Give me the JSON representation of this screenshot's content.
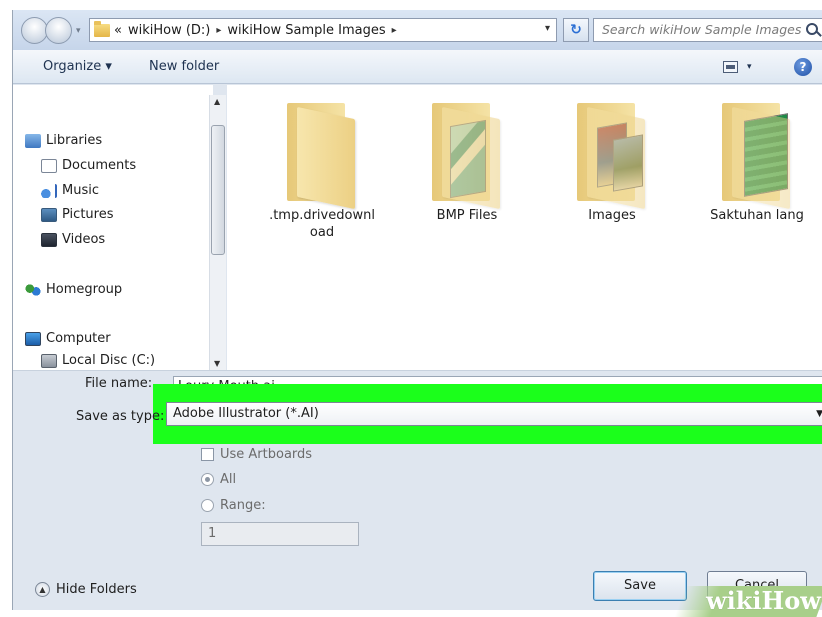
{
  "address_bar": {
    "crumb_prefix": "«",
    "crumbs": [
      "wikiHow (D:)",
      "wikiHow Sample Images"
    ],
    "separator": "▸",
    "search_placeholder": "Search wikiHow Sample Images"
  },
  "toolbar": {
    "organize_label": "Organize ▾",
    "new_folder_label": "New folder",
    "view_drop": "▾",
    "help_glyph": "?"
  },
  "nav_pane": {
    "items": [
      {
        "label": "Libraries",
        "icon": "libraries-icon"
      },
      {
        "label": "Documents",
        "icon": "documents-icon"
      },
      {
        "label": "Music",
        "icon": "music-icon"
      },
      {
        "label": "Pictures",
        "icon": "pictures-icon"
      },
      {
        "label": "Videos",
        "icon": "videos-icon"
      },
      {
        "label": "Homegroup",
        "icon": "homegroup-icon"
      },
      {
        "label": "Computer",
        "icon": "computer-icon"
      },
      {
        "label": "Local Disc (C:)",
        "icon": "local-disk-icon"
      }
    ]
  },
  "files": [
    {
      "line1": ".tmp.drivedownl",
      "line2": "oad"
    },
    {
      "line1": "BMP Files",
      "line2": ""
    },
    {
      "line1": "Images",
      "line2": ""
    },
    {
      "line1": "Saktuhan lang",
      "line2": ""
    }
  ],
  "form": {
    "file_name_label": "File name:",
    "file_name_value": "Loury Mouth.ai",
    "save_type_label": "Save as type:",
    "save_type_value": "Adobe Illustrator (*.AI)",
    "use_artboards_label": "Use Artboards",
    "all_label": "All",
    "range_label": "Range:",
    "range_value": "1"
  },
  "footer": {
    "hide_folders_label": "Hide Folders",
    "save_label": "Save",
    "cancel_label": "Cancel"
  },
  "watermark": {
    "part1": "wiki",
    "part2": "How"
  },
  "colors": {
    "highlight": "#1bff1b",
    "accent": "#2b6fd4"
  }
}
